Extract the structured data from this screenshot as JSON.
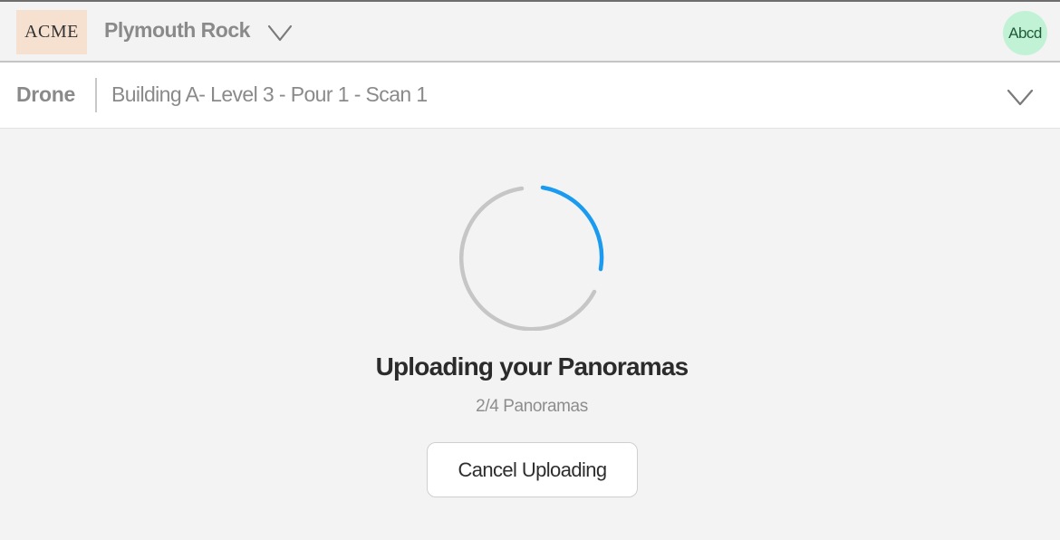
{
  "header": {
    "logo_text": "ACME",
    "project_name": "Plymouth Rock",
    "project_dropdown_icon": "chevron-down-icon",
    "avatar_text": "Abcd",
    "avatar_color": "#c2f2d5",
    "logo_color": "#f6e0cf"
  },
  "subheader": {
    "source_label": "Drone",
    "scan_name": "Building A- Level 3 - Pour 1 - Scan 1",
    "scan_dropdown_icon": "chevron-down-icon"
  },
  "upload": {
    "spinner_icon": "loading-spinner-icon",
    "spinner_accent_color": "#1a9bf0",
    "spinner_track_color": "#c6c6c6",
    "title": "Uploading your Panoramas",
    "progress_text": "2/4 Panoramas",
    "progress_completed": 2,
    "progress_total": 4,
    "cancel_label": "Cancel Uploading"
  }
}
